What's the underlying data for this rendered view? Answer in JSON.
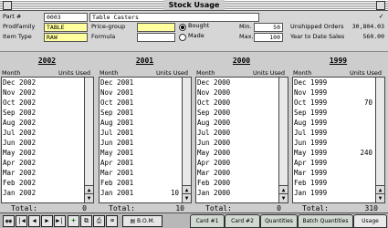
{
  "window": {
    "title": "Stock Usage"
  },
  "header": {
    "part_label": "Part #",
    "part_value": "0003",
    "description_value": "Table Casters",
    "prodfamily_label": "ProdFamily",
    "prodfamily_value": "TABLE",
    "pricegroup_label": "Price-group",
    "pricegroup_value": "",
    "itemtype_label": "Item Type",
    "itemtype_value": "RAW",
    "formula_label": "Formula",
    "formula_value": "",
    "bought_label": "Bought",
    "made_label": "Made",
    "bought_selected": true,
    "min_label": "Min.",
    "min_value": "50",
    "max_label": "Max.",
    "max_value": "100",
    "unshipped_label": "Unshipped Orders",
    "unshipped_value": "30,804.03",
    "ytd_label": "Year to Date Sales",
    "ytd_value": "560.00",
    "check_mark": "✓"
  },
  "usage": {
    "month_label": "Month",
    "units_label": "Units Used",
    "total_label": "Total:",
    "years": [
      {
        "year": "2002",
        "total": "0",
        "rows": [
          {
            "m": "Dec 2002",
            "u": ""
          },
          {
            "m": "Nov 2002",
            "u": ""
          },
          {
            "m": "Oct 2002",
            "u": ""
          },
          {
            "m": "Sep 2002",
            "u": ""
          },
          {
            "m": "Aug 2002",
            "u": ""
          },
          {
            "m": "Jul 2002",
            "u": ""
          },
          {
            "m": "Jun 2002",
            "u": ""
          },
          {
            "m": "May 2002",
            "u": ""
          },
          {
            "m": "Apr 2002",
            "u": ""
          },
          {
            "m": "Mar 2002",
            "u": ""
          },
          {
            "m": "Feb 2002",
            "u": ""
          },
          {
            "m": "Jan 2002",
            "u": ""
          }
        ]
      },
      {
        "year": "2001",
        "total": "10",
        "rows": [
          {
            "m": "Dec 2001",
            "u": ""
          },
          {
            "m": "Nov 2001",
            "u": ""
          },
          {
            "m": "Oct 2001",
            "u": ""
          },
          {
            "m": "Sep 2001",
            "u": ""
          },
          {
            "m": "Aug 2001",
            "u": ""
          },
          {
            "m": "Jul 2001",
            "u": ""
          },
          {
            "m": "Jun 2001",
            "u": ""
          },
          {
            "m": "May 2001",
            "u": ""
          },
          {
            "m": "Apr 2001",
            "u": ""
          },
          {
            "m": "Mar 2001",
            "u": ""
          },
          {
            "m": "Feb 2001",
            "u": ""
          },
          {
            "m": "Jan 2001",
            "u": "10"
          }
        ]
      },
      {
        "year": "2000",
        "total": "0",
        "rows": [
          {
            "m": "Dec 2000",
            "u": ""
          },
          {
            "m": "Nov 2000",
            "u": ""
          },
          {
            "m": "Oct 2000",
            "u": ""
          },
          {
            "m": "Sep 2000",
            "u": ""
          },
          {
            "m": "Aug 2000",
            "u": ""
          },
          {
            "m": "Jul 2000",
            "u": ""
          },
          {
            "m": "Jun 2000",
            "u": ""
          },
          {
            "m": "May 2000",
            "u": ""
          },
          {
            "m": "Apr 2000",
            "u": ""
          },
          {
            "m": "Mar 2000",
            "u": ""
          },
          {
            "m": "Feb 2000",
            "u": ""
          },
          {
            "m": "Jan 2000",
            "u": ""
          }
        ]
      },
      {
        "year": "1999",
        "total": "310",
        "rows": [
          {
            "m": "Dec 1999",
            "u": ""
          },
          {
            "m": "Nov 1999",
            "u": ""
          },
          {
            "m": "Oct 1999",
            "u": "70"
          },
          {
            "m": "Sep 1999",
            "u": ""
          },
          {
            "m": "Aug 1999",
            "u": ""
          },
          {
            "m": "Jul 1999",
            "u": ""
          },
          {
            "m": "Jun 1999",
            "u": ""
          },
          {
            "m": "May 1999",
            "u": "240"
          },
          {
            "m": "Apr 1999",
            "u": ""
          },
          {
            "m": "Mar 1999",
            "u": ""
          },
          {
            "m": "Feb 1999",
            "u": ""
          },
          {
            "m": "Jan 1999",
            "u": ""
          }
        ]
      }
    ]
  },
  "toolbar": {
    "binoculars_icon": "binoculars-icon",
    "first_glyph": "|◀",
    "prev_glyph": "◀",
    "next_glyph": "▶",
    "last_glyph": "▶|",
    "add_glyph": "+",
    "bom_label": "B.O.M."
  },
  "tabs": [
    {
      "label": "Card #1",
      "active": false
    },
    {
      "label": "Card #2",
      "active": false
    },
    {
      "label": "Quantities",
      "active": false
    },
    {
      "label": "Batch Quantities",
      "active": false
    },
    {
      "label": "Usage",
      "active": true
    }
  ],
  "colors": {
    "field_highlight": "#ffff9e",
    "tab_bg": "#cfd9cf"
  }
}
